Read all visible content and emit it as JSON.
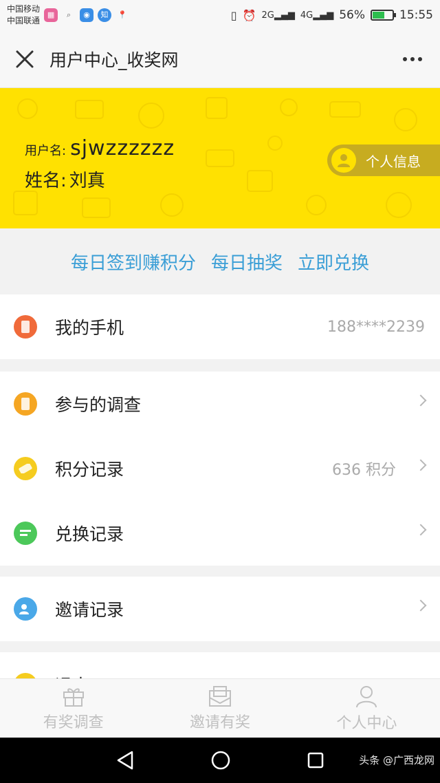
{
  "statusbar": {
    "carrier1": "中国移动",
    "carrier2": "中国联通",
    "battery": "56%",
    "time": "15:55"
  },
  "titlebar": {
    "title": "用户中心_收奖网"
  },
  "profile": {
    "username_label": "用户名:",
    "username": "sjwzzzzzz",
    "realname_label": "姓名:",
    "realname": "刘真",
    "info_button": "个人信息"
  },
  "links": [
    "每日签到赚积分",
    "每日抽奖",
    "立即兑换"
  ],
  "sections": [
    {
      "rows": [
        {
          "label": "我的手机",
          "value": "188****2239",
          "icon_color": "#f06a3a",
          "chevron": false
        }
      ]
    },
    {
      "rows": [
        {
          "label": "参与的调查",
          "value": "",
          "icon_color": "#f5a623",
          "chevron": true
        },
        {
          "label": "积分记录",
          "value": "636 积分",
          "icon_color": "#f5cc1f",
          "chevron": true
        },
        {
          "label": "兑换记录",
          "value": "",
          "icon_color": "#4cc85a",
          "chevron": true
        }
      ]
    },
    {
      "rows": [
        {
          "label": "邀请记录",
          "value": "",
          "icon_color": "#4aa8e8",
          "chevron": true
        }
      ]
    },
    {
      "rows": [
        {
          "label": "退出",
          "value": "",
          "icon_color": "#f5cc1f",
          "chevron": false
        }
      ]
    }
  ],
  "bottomnav": {
    "items": [
      "有奖调查",
      "邀请有奖",
      "个人中心"
    ]
  },
  "watermark": "头条 @广西龙网"
}
